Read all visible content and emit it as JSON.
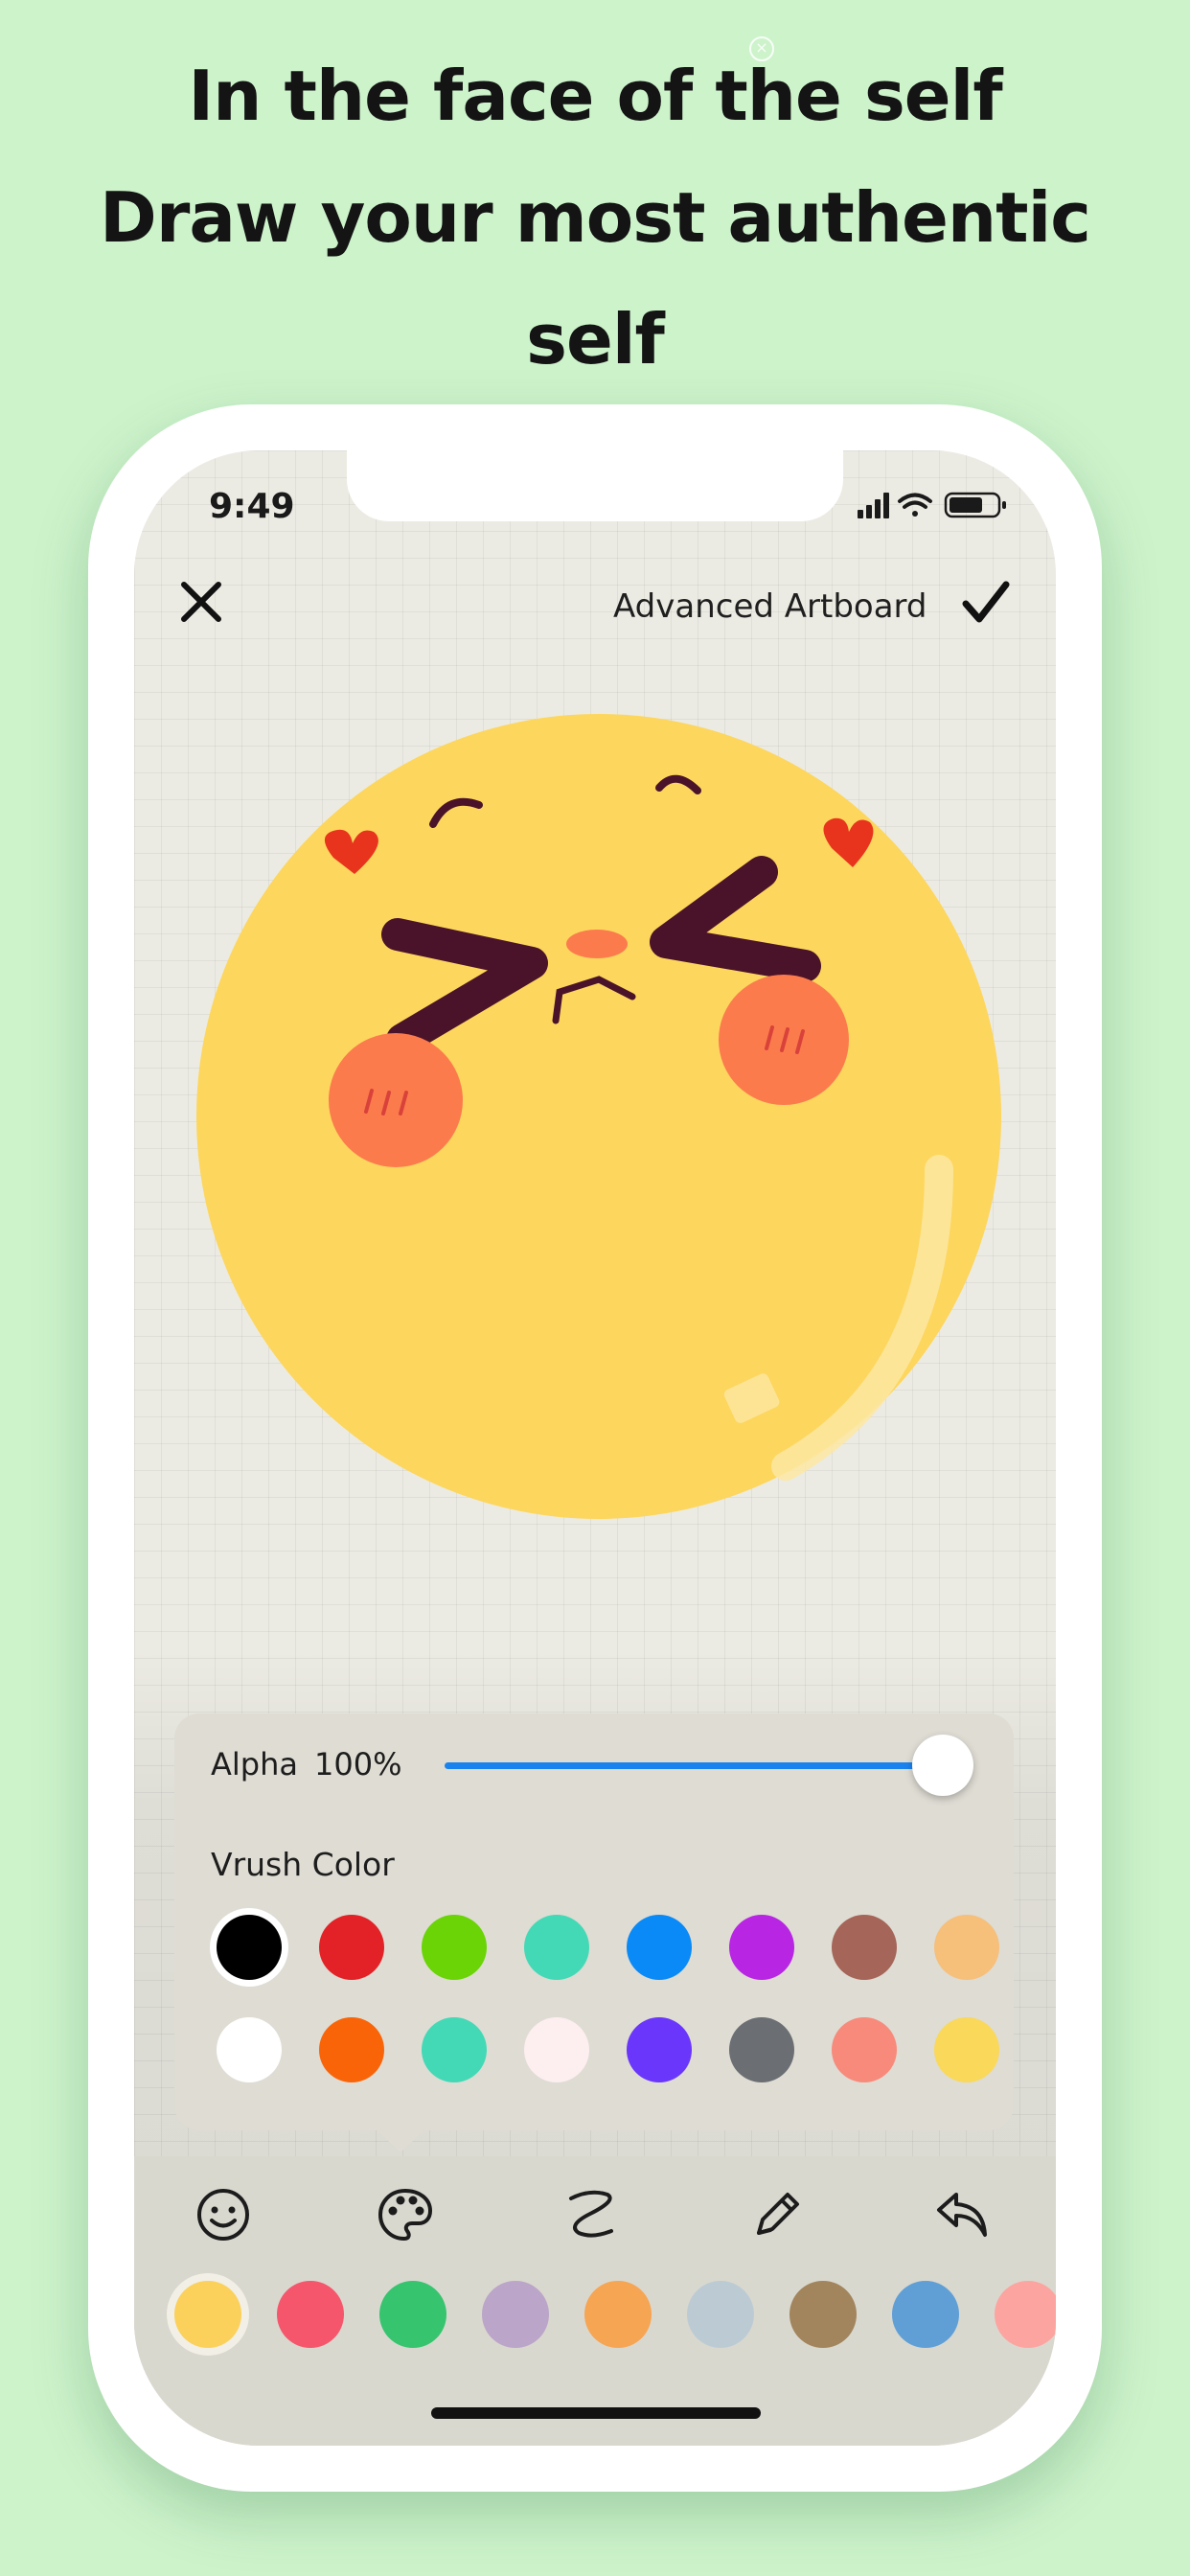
{
  "promo": {
    "line1": "In the face of the self",
    "line2": "Draw your most authentic",
    "line3": "self"
  },
  "status_bar": {
    "time": "9:49",
    "icons": [
      "signal-icon",
      "wifi-icon",
      "battery-icon"
    ]
  },
  "top_bar": {
    "close_icon": "close-icon",
    "title": "Advanced Artboard",
    "confirm_icon": "checkmark-icon"
  },
  "canvas": {
    "drawing": "smiling emoji face with hearts",
    "colors": {
      "face": "#fdd65e",
      "eyes": "#4a1329",
      "cheeks": "#fb7b4c",
      "hearts": "#e8341c"
    }
  },
  "color_panel": {
    "alpha_label": "Alpha",
    "alpha_value": "100%",
    "alpha_fraction": 1.0,
    "brush_color_label": "Vrush Color",
    "swatch_rows": [
      [
        "#000000",
        "#e22226",
        "#6ad406",
        "#43d9b6",
        "#0a8af7",
        "#b826e3",
        "#a56558",
        "#f6bf7a"
      ],
      [
        "#ffffff",
        "#fa6408",
        "#43d9b6",
        "#fdeef0",
        "#6a36fb",
        "#6b6f73",
        "#f88a7b",
        "#fad85a"
      ]
    ],
    "selected_swatch": "#000000"
  },
  "toolbar": {
    "tools": [
      "emoji-icon",
      "palette-icon",
      "brush-stroke-icon",
      "pencil-icon",
      "undo-icon"
    ],
    "active_tool": "palette-icon",
    "palette": [
      "#fbd15b",
      "#f5566b",
      "#37c46f",
      "#bba5c8",
      "#f6a553",
      "#bccbd3",
      "#a2855d",
      "#609fd6",
      "#fca5a0"
    ],
    "selected_palette_color": "#fbd15b"
  }
}
